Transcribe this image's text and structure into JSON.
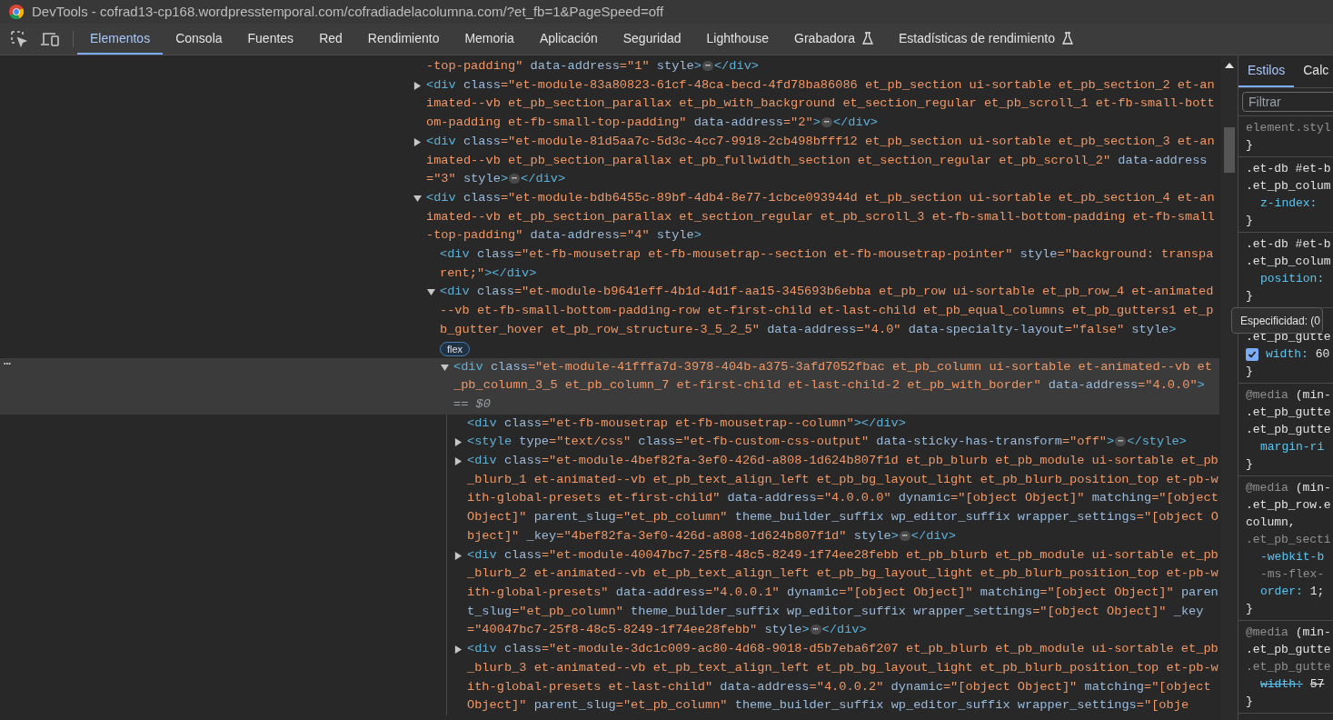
{
  "window": {
    "title": "DevTools - cofrad13-cp168.wordpresstemporal.com/cofradiadelacolumna.com/?et_fb=1&PageSpeed=off"
  },
  "tabs": [
    {
      "label": "Elementos",
      "selected": true,
      "experimental": false
    },
    {
      "label": "Consola",
      "selected": false,
      "experimental": false
    },
    {
      "label": "Fuentes",
      "selected": false,
      "experimental": false
    },
    {
      "label": "Red",
      "selected": false,
      "experimental": false
    },
    {
      "label": "Rendimiento",
      "selected": false,
      "experimental": false
    },
    {
      "label": "Memoria",
      "selected": false,
      "experimental": false
    },
    {
      "label": "Aplicación",
      "selected": false,
      "experimental": false
    },
    {
      "label": "Seguridad",
      "selected": false,
      "experimental": false
    },
    {
      "label": "Lighthouse",
      "selected": false,
      "experimental": false
    },
    {
      "label": "Grabadora",
      "selected": false,
      "experimental": true
    },
    {
      "label": "Estadísticas de rendimiento",
      "selected": false,
      "experimental": true
    }
  ],
  "dom_tree": {
    "nodes": [
      {
        "selected": false,
        "tokens": [
          {
            "kind": "value",
            "text": "-top-padding\""
          },
          {
            "kind": "attr",
            "text": "data-address"
          },
          {
            "kind": "value",
            "text": "=\"1\""
          },
          {
            "kind": "attr",
            "text": "style"
          },
          {
            "kind": "tag",
            "text": ">"
          },
          {
            "kind": "ellipsis",
            "text": "⋯"
          },
          {
            "kind": "tag",
            "text": "</div>"
          }
        ]
      },
      {
        "selected": false,
        "expanded": false,
        "tokens": [
          {
            "kind": "tag",
            "text": "<div"
          },
          {
            "kind": "attr",
            "text": "class"
          },
          {
            "kind": "value",
            "text": "=\"et-module-83a80823-61cf-48ca-becd-4fd78ba86086 et_pb_section ui-sortable et_pb_section_2 et-animated--vb et_pb_section_parallax et_pb_with_background et_section_regular et_pb_scroll_1 et-fb-small-bottom-padding et-fb-small-top-padding\""
          },
          {
            "kind": "attr",
            "text": "data-address"
          },
          {
            "kind": "value",
            "text": "=\"2\""
          },
          {
            "kind": "tag",
            "text": ">"
          },
          {
            "kind": "ellipsis",
            "text": "⋯"
          },
          {
            "kind": "tag",
            "text": "</div>"
          }
        ]
      },
      {
        "selected": false,
        "expanded": false,
        "tokens": [
          {
            "kind": "tag",
            "text": "<div"
          },
          {
            "kind": "attr",
            "text": "class"
          },
          {
            "kind": "value",
            "text": "=\"et-module-81d5aa7c-5d3c-4cc7-9918-2cb498bfff12 et_pb_section ui-sortable et_pb_section_3 et-animated--vb et_pb_section_parallax et_pb_fullwidth_section et_section_regular et_pb_scroll_2\""
          },
          {
            "kind": "attr",
            "text": "data-address"
          },
          {
            "kind": "value",
            "text": "=\"3\""
          },
          {
            "kind": "attr",
            "text": "style"
          },
          {
            "kind": "tag",
            "text": ">"
          },
          {
            "kind": "ellipsis",
            "text": "⋯"
          },
          {
            "kind": "tag",
            "text": "</div>"
          }
        ]
      },
      {
        "selected": false,
        "expanded": true,
        "tokens": [
          {
            "kind": "tag",
            "text": "<div"
          },
          {
            "kind": "attr",
            "text": "class"
          },
          {
            "kind": "value",
            "text": "=\"et-module-bdb6455c-89bf-4db4-8e77-1cbce093944d et_pb_section ui-sortable et_pb_section_4 et-animated--vb et_pb_section_parallax et_section_regular et_pb_scroll_3 et-fb-small-bottom-padding et-fb-small-top-padding\""
          },
          {
            "kind": "attr",
            "text": "data-address"
          },
          {
            "kind": "value",
            "text": "=\"4\""
          },
          {
            "kind": "attr",
            "text": "style"
          },
          {
            "kind": "tag",
            "text": ">"
          }
        ],
        "children": [
          {
            "selected": false,
            "tokens": [
              {
                "kind": "tag",
                "text": "<div"
              },
              {
                "kind": "attr",
                "text": "class"
              },
              {
                "kind": "value",
                "text": "=\"et-fb-mousetrap et-fb-mousetrap--section et-fb-mousetrap-pointer\""
              },
              {
                "kind": "attr",
                "text": "style"
              },
              {
                "kind": "value",
                "text": "=\"background: transparent;\""
              },
              {
                "kind": "tag",
                "text": "></div>"
              }
            ]
          },
          {
            "selected": false,
            "expanded": true,
            "badge": "flex",
            "tokens": [
              {
                "kind": "tag",
                "text": "<div"
              },
              {
                "kind": "attr",
                "text": "class"
              },
              {
                "kind": "value",
                "text": "=\"et-module-b9641eff-4b1d-4d1f-aa15-345693b6ebba et_pb_row ui-sortable et_pb_row_4 et-animated--vb et-fb-small-bottom-padding-row et-first-child et-last-child et_pb_equal_columns et_pb_gutters1 et_pb_gutter_hover et_pb_row_structure-3_5_2_5\""
              },
              {
                "kind": "attr",
                "text": "data-address"
              },
              {
                "kind": "value",
                "text": "=\"4.0\""
              },
              {
                "kind": "attr",
                "text": "data-specialty-layout"
              },
              {
                "kind": "value",
                "text": "=\"false\""
              },
              {
                "kind": "attr",
                "text": "style"
              },
              {
                "kind": "tag",
                "text": ">"
              }
            ],
            "children": [
              {
                "selected": true,
                "expanded": true,
                "gutter_text": "⋯",
                "tokens": [
                  {
                    "kind": "tag",
                    "text": "<div"
                  },
                  {
                    "kind": "attr",
                    "text": "class"
                  },
                  {
                    "kind": "value",
                    "text": "=\"et-module-41fffa7d-3978-404b-a375-3afd7052fbac et_pb_column ui-sortable et-animated--vb et_pb_column_3_5 et_pb_column_7 et-first-child et-last-child-2 et_pb_with_border\""
                  },
                  {
                    "kind": "attr",
                    "text": "data-address"
                  },
                  {
                    "kind": "value",
                    "text": "=\"4.0.0\""
                  },
                  {
                    "kind": "tag",
                    "text": ">"
                  },
                  {
                    "kind": "marker",
                    "text": "== $0"
                  }
                ],
                "children": [
                  {
                    "selected": false,
                    "tokens": [
                      {
                        "kind": "tag",
                        "text": "<div"
                      },
                      {
                        "kind": "attr",
                        "text": "class"
                      },
                      {
                        "kind": "value",
                        "text": "=\"et-fb-mousetrap et-fb-mousetrap--column\""
                      },
                      {
                        "kind": "tag",
                        "text": "></div>"
                      }
                    ]
                  },
                  {
                    "selected": false,
                    "expanded": false,
                    "tokens": [
                      {
                        "kind": "tag",
                        "text": "<style"
                      },
                      {
                        "kind": "attr",
                        "text": "type"
                      },
                      {
                        "kind": "value",
                        "text": "=\"text/css\""
                      },
                      {
                        "kind": "attr",
                        "text": "class"
                      },
                      {
                        "kind": "value",
                        "text": "=\"et-fb-custom-css-output\""
                      },
                      {
                        "kind": "attr",
                        "text": "data-sticky-has-transform"
                      },
                      {
                        "kind": "value",
                        "text": "=\"off\""
                      },
                      {
                        "kind": "tag",
                        "text": ">"
                      },
                      {
                        "kind": "ellipsis",
                        "text": "⋯"
                      },
                      {
                        "kind": "tag",
                        "text": "</style>"
                      }
                    ]
                  },
                  {
                    "selected": false,
                    "expanded": false,
                    "tokens": [
                      {
                        "kind": "tag",
                        "text": "<div"
                      },
                      {
                        "kind": "attr",
                        "text": "class"
                      },
                      {
                        "kind": "value",
                        "text": "=\"et-module-4bef82fa-3ef0-426d-a808-1d624b807f1d et_pb_blurb et_pb_module ui-sortable et_pb_blurb_1 et-animated--vb et_pb_text_align_left et_pb_bg_layout_light et_pb_blurb_position_top et-pb-with-global-presets et-first-child\""
                      },
                      {
                        "kind": "attr",
                        "text": "data-address"
                      },
                      {
                        "kind": "value",
                        "text": "=\"4.0.0.0\""
                      },
                      {
                        "kind": "attr",
                        "text": "dynamic"
                      },
                      {
                        "kind": "value",
                        "text": "=\"[object Object]\""
                      },
                      {
                        "kind": "attr",
                        "text": "matching"
                      },
                      {
                        "kind": "value",
                        "text": "=\"[object Object]\""
                      },
                      {
                        "kind": "attr",
                        "text": "parent_slug"
                      },
                      {
                        "kind": "value",
                        "text": "=\"et_pb_column\""
                      },
                      {
                        "kind": "attr",
                        "text": "theme_builder_suffix"
                      },
                      {
                        "kind": "attr",
                        "text": "wp_editor_suffix"
                      },
                      {
                        "kind": "attr",
                        "text": "wrapper_settings"
                      },
                      {
                        "kind": "value",
                        "text": "=\"[object Object]\""
                      },
                      {
                        "kind": "attr",
                        "text": "_key"
                      },
                      {
                        "kind": "value",
                        "text": "=\"4bef82fa-3ef0-426d-a808-1d624b807f1d\""
                      },
                      {
                        "kind": "attr",
                        "text": "style"
                      },
                      {
                        "kind": "tag",
                        "text": ">"
                      },
                      {
                        "kind": "ellipsis",
                        "text": "⋯"
                      },
                      {
                        "kind": "tag",
                        "text": "</div>"
                      }
                    ]
                  },
                  {
                    "selected": false,
                    "expanded": false,
                    "tokens": [
                      {
                        "kind": "tag",
                        "text": "<div"
                      },
                      {
                        "kind": "attr",
                        "text": "class"
                      },
                      {
                        "kind": "value",
                        "text": "=\"et-module-40047bc7-25f8-48c5-8249-1f74ee28febb et_pb_blurb et_pb_module ui-sortable et_pb_blurb_2 et-animated--vb et_pb_text_align_left et_pb_bg_layout_light et_pb_blurb_position_top et-pb-with-global-presets\""
                      },
                      {
                        "kind": "attr",
                        "text": "data-address"
                      },
                      {
                        "kind": "value",
                        "text": "=\"4.0.0.1\""
                      },
                      {
                        "kind": "attr",
                        "text": "dynamic"
                      },
                      {
                        "kind": "value",
                        "text": "=\"[object Object]\""
                      },
                      {
                        "kind": "attr",
                        "text": "matching"
                      },
                      {
                        "kind": "value",
                        "text": "=\"[object Object]\""
                      },
                      {
                        "kind": "attr",
                        "text": "parent_slug"
                      },
                      {
                        "kind": "value",
                        "text": "=\"et_pb_column\""
                      },
                      {
                        "kind": "attr",
                        "text": "theme_builder_suffix"
                      },
                      {
                        "kind": "attr",
                        "text": "wp_editor_suffix"
                      },
                      {
                        "kind": "attr",
                        "text": "wrapper_settings"
                      },
                      {
                        "kind": "value",
                        "text": "=\"[object Object]\""
                      },
                      {
                        "kind": "attr",
                        "text": "_key"
                      },
                      {
                        "kind": "value",
                        "text": "=\"40047bc7-25f8-48c5-8249-1f74ee28febb\""
                      },
                      {
                        "kind": "attr",
                        "text": "style"
                      },
                      {
                        "kind": "tag",
                        "text": ">"
                      },
                      {
                        "kind": "ellipsis",
                        "text": "⋯"
                      },
                      {
                        "kind": "tag",
                        "text": "</div>"
                      }
                    ]
                  },
                  {
                    "selected": false,
                    "expanded": false,
                    "tokens": [
                      {
                        "kind": "tag",
                        "text": "<div"
                      },
                      {
                        "kind": "attr",
                        "text": "class"
                      },
                      {
                        "kind": "value",
                        "text": "=\"et-module-3dc1c009-ac80-4d68-9018-d5b7eba6f207 et_pb_blurb et_pb_module ui-sortable et_pb_blurb_3 et-animated--vb et_pb_text_align_left et_pb_bg_layout_light et_pb_blurb_position_top et-pb-with-global-presets et-last-child\""
                      },
                      {
                        "kind": "attr",
                        "text": "data-address"
                      },
                      {
                        "kind": "value",
                        "text": "=\"4.0.0.2\""
                      },
                      {
                        "kind": "attr",
                        "text": "dynamic"
                      },
                      {
                        "kind": "value",
                        "text": "=\"[object Object]\""
                      },
                      {
                        "kind": "attr",
                        "text": "matching"
                      },
                      {
                        "kind": "value",
                        "text": "=\"[object Object]\""
                      },
                      {
                        "kind": "attr",
                        "text": "parent_slug"
                      },
                      {
                        "kind": "value",
                        "text": "=\"et_pb_column\""
                      },
                      {
                        "kind": "attr",
                        "text": "theme_builder_suffix"
                      },
                      {
                        "kind": "attr",
                        "text": "wp_editor_suffix"
                      },
                      {
                        "kind": "attr",
                        "text": "wrapper_settings"
                      },
                      {
                        "kind": "value",
                        "text": "=\"[obje"
                      }
                    ]
                  }
                ]
              }
            ]
          }
        ]
      }
    ]
  },
  "styles_panel": {
    "tabs": [
      {
        "label": "Estilos",
        "selected": true
      },
      {
        "label": "Calc",
        "selected": false
      }
    ],
    "filter": {
      "placeholder": "Filtrar"
    },
    "rules": [
      {
        "lines": [
          {
            "kind": "selector",
            "text": "element.styl",
            "dim": true
          },
          {
            "kind": "brace",
            "text": "}"
          }
        ]
      },
      {
        "lines": [
          {
            "kind": "selector",
            "text": ".et-db #et-b"
          },
          {
            "kind": "selector",
            "text": ".et_pb_colum"
          },
          {
            "kind": "property",
            "name": "z-index:"
          },
          {
            "kind": "brace",
            "text": "}"
          }
        ]
      },
      {
        "lines": [
          {
            "kind": "selector",
            "text": ".et-db #et-b"
          },
          {
            "kind": "selector",
            "text": ".et_pb_colum"
          },
          {
            "kind": "property",
            "name": "position:"
          },
          {
            "kind": "brace",
            "text": "}"
          }
        ]
      },
      {
        "lines": [
          {
            "kind": "covered"
          },
          {
            "kind": "selector",
            "text": ".et_pb_gutte"
          },
          {
            "kind": "property",
            "name": "width:",
            "value": "60",
            "checked": true
          },
          {
            "kind": "brace",
            "text": "}"
          }
        ]
      },
      {
        "lines": [
          {
            "kind": "media",
            "text": "@media",
            "condition": "(min-"
          },
          {
            "kind": "selector",
            "text": ".et_pb_gutte"
          },
          {
            "kind": "selector",
            "text": ".et_pb_gutte"
          },
          {
            "kind": "property",
            "name": "margin-ri"
          },
          {
            "kind": "brace",
            "text": "}"
          }
        ]
      },
      {
        "lines": [
          {
            "kind": "media",
            "text": "@media",
            "condition": "(min-"
          },
          {
            "kind": "selector",
            "text": ".et_pb_row.e"
          },
          {
            "kind": "selector",
            "text": "column,"
          },
          {
            "kind": "selector",
            "text": ".et_pb_secti",
            "dim": true
          },
          {
            "kind": "property",
            "name": "-webkit-b"
          },
          {
            "kind": "property",
            "name": "-ms-flex-",
            "dim": true
          },
          {
            "kind": "property",
            "name": "order:",
            "value": "1;"
          },
          {
            "kind": "brace",
            "text": "}"
          }
        ]
      },
      {
        "lines": [
          {
            "kind": "media",
            "text": "@media",
            "condition": "(min-"
          },
          {
            "kind": "selector",
            "text": ".et_pb_gutte"
          },
          {
            "kind": "selector",
            "text": ".et_pb_gutte",
            "dim": true
          },
          {
            "kind": "property",
            "name": "width:",
            "value": "57",
            "struck": true
          },
          {
            "kind": "brace",
            "text": "}"
          }
        ]
      }
    ]
  },
  "tooltip": {
    "text": "Especificidad: (0"
  }
}
